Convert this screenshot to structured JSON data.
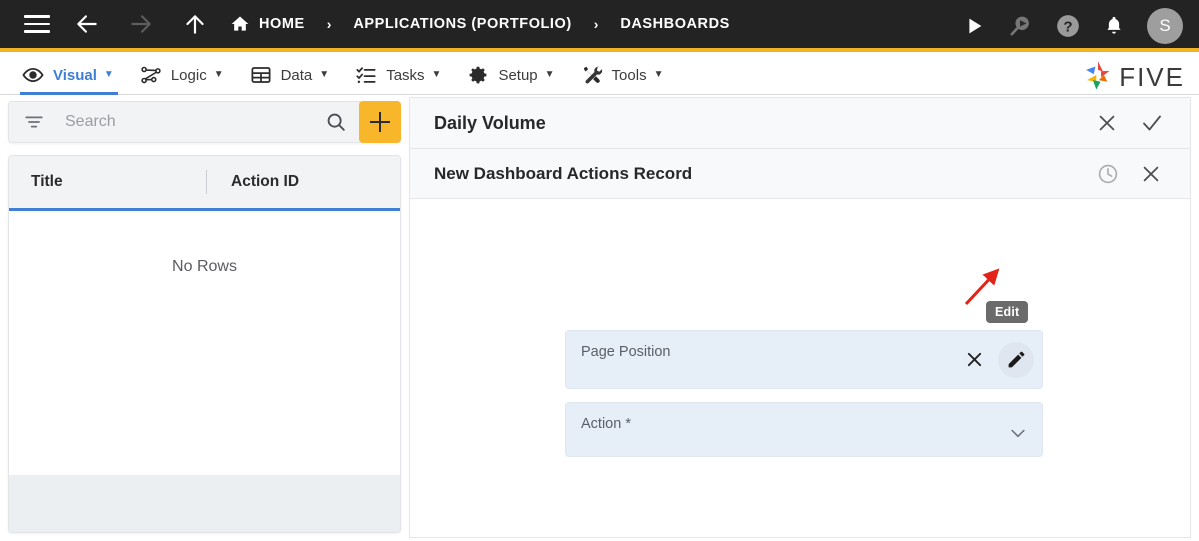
{
  "topbar": {
    "menu_icon": "hamburger-icon",
    "back_icon": "arrow-left-icon",
    "forward_icon": "arrow-right-icon",
    "up_icon": "arrow-up-icon",
    "breadcrumb": [
      {
        "label": "HOME",
        "icon": "home-icon"
      },
      {
        "label": "APPLICATIONS (PORTFOLIO)",
        "icon": ""
      },
      {
        "label": "DASHBOARDS",
        "icon": ""
      }
    ],
    "separator": "›",
    "actions": [
      {
        "name": "run-icon",
        "label": ""
      },
      {
        "name": "search-run-icon",
        "label": ""
      },
      {
        "name": "help-icon",
        "label": ""
      },
      {
        "name": "notifications-bell-icon",
        "label": ""
      }
    ],
    "avatar_initial": "S"
  },
  "menubar": {
    "items": [
      {
        "label": "Visual",
        "icon": "eye-icon",
        "caret": "▼",
        "active": true
      },
      {
        "label": "Logic",
        "icon": "logic-nodes-icon",
        "caret": "▼",
        "active": false
      },
      {
        "label": "Data",
        "icon": "table-grid-icon",
        "caret": "▼",
        "active": false
      },
      {
        "label": "Tasks",
        "icon": "checklist-icon",
        "caret": "▼",
        "active": false
      },
      {
        "label": "Setup",
        "icon": "gear-icon",
        "caret": "▼",
        "active": false
      },
      {
        "label": "Tools",
        "icon": "wrench-screwdriver-icon",
        "caret": "▼",
        "active": false
      }
    ],
    "brand": "FIVE"
  },
  "left_panel": {
    "search": {
      "placeholder": "Search",
      "value": "",
      "filter_icon": "filter-icon",
      "search_icon": "search-icon"
    },
    "add_button_label": "+",
    "grid": {
      "columns": [
        "Title",
        "Action ID"
      ],
      "rows": [],
      "empty_message": "No Rows"
    }
  },
  "right_panel": {
    "header": {
      "title": "Daily Volume",
      "actions": [
        {
          "name": "close-icon",
          "glyph": "✕"
        },
        {
          "name": "confirm-check-icon",
          "glyph": "✓"
        }
      ]
    },
    "record": {
      "title": "New Dashboard Actions Record",
      "actions": [
        {
          "name": "history-clock-icon",
          "glyph": ""
        },
        {
          "name": "close-icon",
          "glyph": "✕"
        }
      ]
    },
    "form": {
      "fields": [
        {
          "label": "Page Position",
          "value": "",
          "required": false,
          "type": "lookup",
          "icons": [
            "clear-x-icon",
            "edit-pencil-icon"
          ]
        },
        {
          "label": "Action *",
          "value": "",
          "required": true,
          "type": "select",
          "icons": [
            "chevron-down-icon"
          ]
        }
      ]
    },
    "tooltip": {
      "text": "Edit",
      "target": "edit-pencil-icon"
    },
    "annotation": {
      "type": "red-arrow",
      "points_to": "edit-pencil-icon"
    }
  },
  "colors": {
    "topbar_bg": "#232323",
    "accent_yellow": "#f0b323",
    "add_button": "#f8b62b",
    "active_blue": "#3f7fd4",
    "field_bg": "#e6eef8",
    "tooltip_bg": "#6b6b6b",
    "annotation_red": "#e2231a",
    "panel_head_bg": "#f8f9fa",
    "grid_head_bg": "#f2f3f5",
    "grid_foot_bg": "#eceff1"
  }
}
